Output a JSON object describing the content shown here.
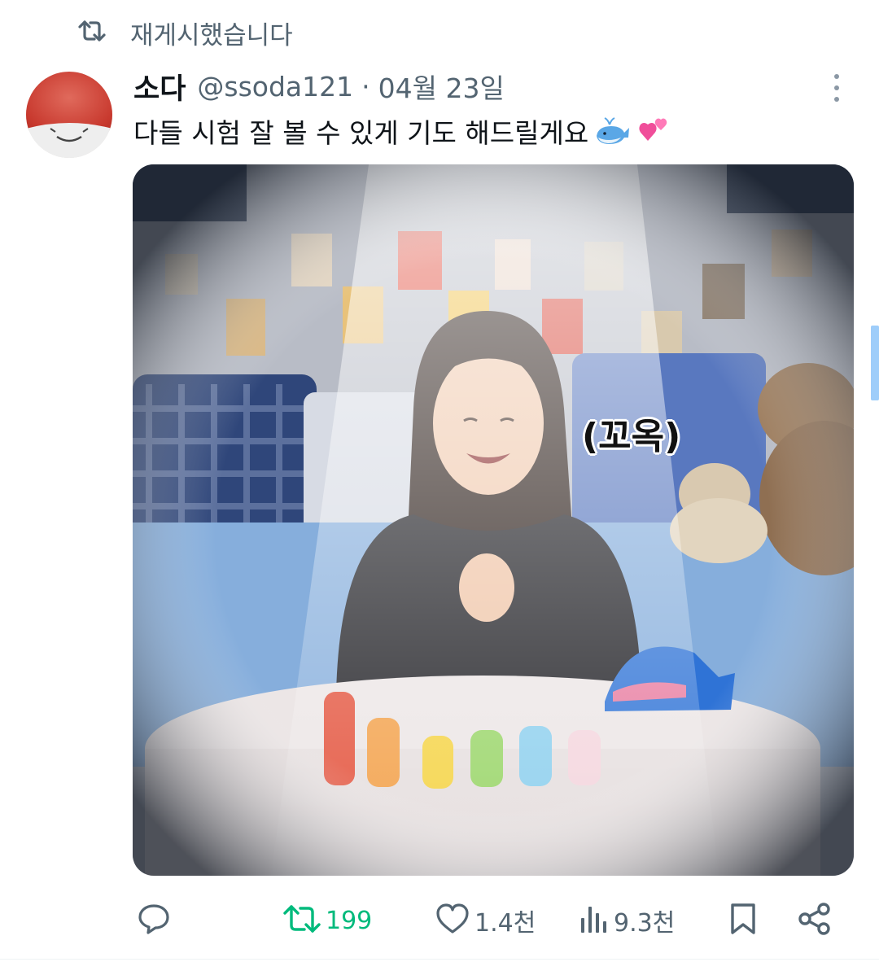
{
  "retweet_header": {
    "text": "재게시했습니다",
    "icon": "repost-icon"
  },
  "tweet": {
    "display_name": "소다",
    "handle": "@ssoda121",
    "separator": "·",
    "date": "04월 23일",
    "text": "다들 시험 잘 볼 수 있게 기도 해드릴게요",
    "emojis": [
      "whale-emoji",
      "two-hearts-emoji"
    ],
    "media": {
      "overlay_caption": "(꼬옥)"
    }
  },
  "actions": {
    "reply": {
      "icon": "reply-icon",
      "count": ""
    },
    "repost": {
      "icon": "repost-icon",
      "count": "199",
      "active": true,
      "color": "#00ba7c"
    },
    "like": {
      "icon": "heart-icon",
      "count": "1.4천"
    },
    "views": {
      "icon": "views-icon",
      "count": "9.3천"
    },
    "bookmark": {
      "icon": "bookmark-icon"
    },
    "share": {
      "icon": "share-icon"
    }
  },
  "colors": {
    "text": "#0f1419",
    "secondary": "#536471",
    "repost_green": "#00ba7c"
  }
}
